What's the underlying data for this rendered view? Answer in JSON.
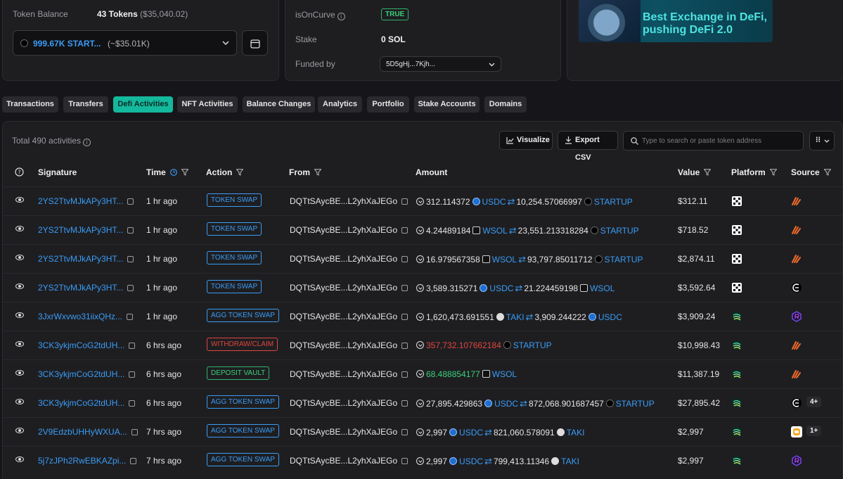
{
  "top_left": {
    "token_balance_label": "Token Balance",
    "token_balance_value": "43 Tokens",
    "token_balance_usd": "($35,040.02)",
    "selected_token": "999.67K START...",
    "selected_token_usd": "(~$35.01K)"
  },
  "top_mid": {
    "is_on_curve_label": "isOnCurve",
    "is_on_curve_value": "TRUE",
    "stake_label": "Stake",
    "stake_value": "0 SOL",
    "funded_by_label": "Funded by",
    "funded_by_value": "5D5gHj...7Kjh..."
  },
  "banner": {
    "line1": "Best Exchange in DeFi,",
    "line2": "pushing DeFi 2.0"
  },
  "tabs": [
    "Transactions",
    "Transfers",
    "Defi Activities",
    "NFT Activities",
    "Balance Changes",
    "Analytics",
    "Portfolio",
    "Stake Accounts",
    "Domains"
  ],
  "active_tab": "Defi Activities",
  "toolbar": {
    "total": "Total 490 activities",
    "visualize": "Visualize",
    "export": "Export CSV",
    "search_placeholder": "Type to search or paste token address"
  },
  "columns": [
    "Signature",
    "Time",
    "Action",
    "From",
    "Amount",
    "Value",
    "Platform",
    "Source"
  ],
  "rows": [
    {
      "sig": "2YS2TtvMJkAPy3HT...",
      "time": "1 hr ago",
      "action": "TOKEN SWAP",
      "from": "DQTtSAycBE...L2yhXaJEGo",
      "a1": "312.114372",
      "t1": "USDC",
      "a2": "10,254.57066997",
      "t2": "STARTUP",
      "value": "$312.11"
    },
    {
      "sig": "2YS2TtvMJkAPy3HT...",
      "time": "1 hr ago",
      "action": "TOKEN SWAP",
      "from": "DQTtSAycBE...L2yhXaJEGo",
      "a1": "4.24489184",
      "t1": "WSOL",
      "a2": "23,551.213318284",
      "t2": "STARTUP",
      "value": "$718.52"
    },
    {
      "sig": "2YS2TtvMJkAPy3HT...",
      "time": "1 hr ago",
      "action": "TOKEN SWAP",
      "from": "DQTtSAycBE...L2yhXaJEGo",
      "a1": "16.979567358",
      "t1": "WSOL",
      "a2": "93,797.85011712",
      "t2": "STARTUP",
      "value": "$2,874.11"
    },
    {
      "sig": "2YS2TtvMJkAPy3HT...",
      "time": "1 hr ago",
      "action": "TOKEN SWAP",
      "from": "DQTtSAycBE...L2yhXaJEGo",
      "a1": "3,589.315271",
      "t1": "USDC",
      "a2": "21.224459198",
      "t2": "WSOL",
      "value": "$3,592.64"
    },
    {
      "sig": "3JxrWxvwo31iixQHz...",
      "time": "1 hr ago",
      "action": "AGG TOKEN SWAP",
      "from": "DQTtSAycBE...L2yhXaJEGo",
      "a1": "1,620,473.691551",
      "t1": "TAKI",
      "a2": "3,909.244222",
      "t2": "USDC",
      "value": "$3,909.24"
    },
    {
      "sig": "3CK3ykjmCoG2tdUH...",
      "time": "6 hrs ago",
      "action": "WITHDRAW/CLAIM",
      "from": "DQTtSAycBE...L2yhXaJEGo",
      "a1": "357,732.107662184",
      "t1": "STARTUP",
      "a2": "",
      "t2": "",
      "value": "$10,998.43"
    },
    {
      "sig": "3CK3ykjmCoG2tdUH...",
      "time": "6 hrs ago",
      "action": "DEPOSIT VAULT",
      "from": "DQTtSAycBE...L2yhXaJEGo",
      "a1": "68.488854177",
      "t1": "WSOL",
      "a2": "",
      "t2": "",
      "value": "$11,387.19"
    },
    {
      "sig": "3CK3ykjmCoG2tdUH...",
      "time": "6 hrs ago",
      "action": "AGG TOKEN SWAP",
      "from": "DQTtSAycBE...L2yhXaJEGo",
      "a1": "27,895.429863",
      "t1": "USDC",
      "a2": "872,068.901687457",
      "t2": "STARTUP",
      "value": "$27,895.42",
      "more": "4+"
    },
    {
      "sig": "2V9EdzbUHHyWXUA...",
      "time": "7 hrs ago",
      "action": "AGG TOKEN SWAP",
      "from": "DQTtSAycBE...L2yhXaJEGo",
      "a1": "2,997",
      "t1": "USDC",
      "a2": "821,060.578091",
      "t2": "TAKI",
      "value": "$2,997",
      "more": "1+"
    },
    {
      "sig": "5j7zJPh2RwEBKAZpi...",
      "time": "7 hrs ago",
      "action": "AGG TOKEN SWAP",
      "from": "DQTtSAycBE...L2yhXaJEGo",
      "a1": "2,997",
      "t1": "USDC",
      "a2": "799,413.11346",
      "t2": "TAKI",
      "value": "$2,997"
    }
  ],
  "colors": {
    "accent": "#14b89c",
    "link": "#3a9cf5",
    "danger": "#e0463f",
    "success": "#3ad07a"
  }
}
